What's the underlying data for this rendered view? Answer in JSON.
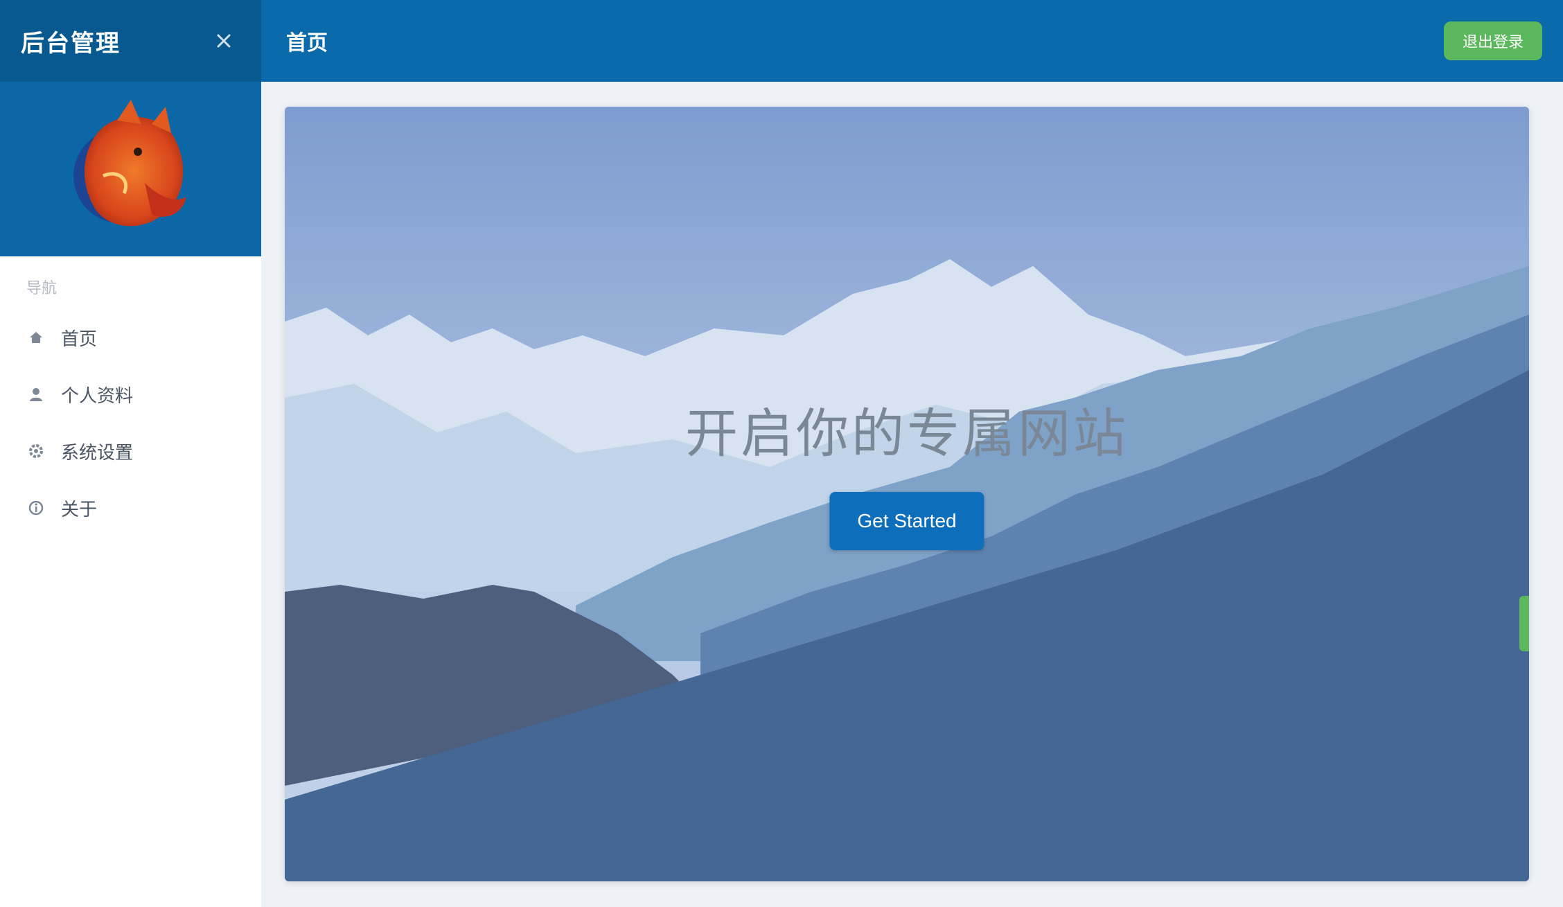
{
  "sidebar": {
    "brand": "后台管理",
    "collapse_icon": "close-icon",
    "group_label": "导航",
    "items": [
      {
        "label": "首页",
        "icon": "home-icon"
      },
      {
        "label": "个人资料",
        "icon": "user-icon"
      },
      {
        "label": "系统设置",
        "icon": "settings-icon"
      },
      {
        "label": "关于",
        "icon": "info-icon"
      }
    ]
  },
  "header": {
    "title": "首页",
    "badge": "退出登录"
  },
  "hero": {
    "title": "开启你的专属网站",
    "button_label": "Get Started"
  },
  "colors": {
    "sidebar_header": "#07598f",
    "topbar": "#0b6aa9",
    "accent_green": "#5cb85c",
    "primary_button": "#0d6fbb"
  }
}
